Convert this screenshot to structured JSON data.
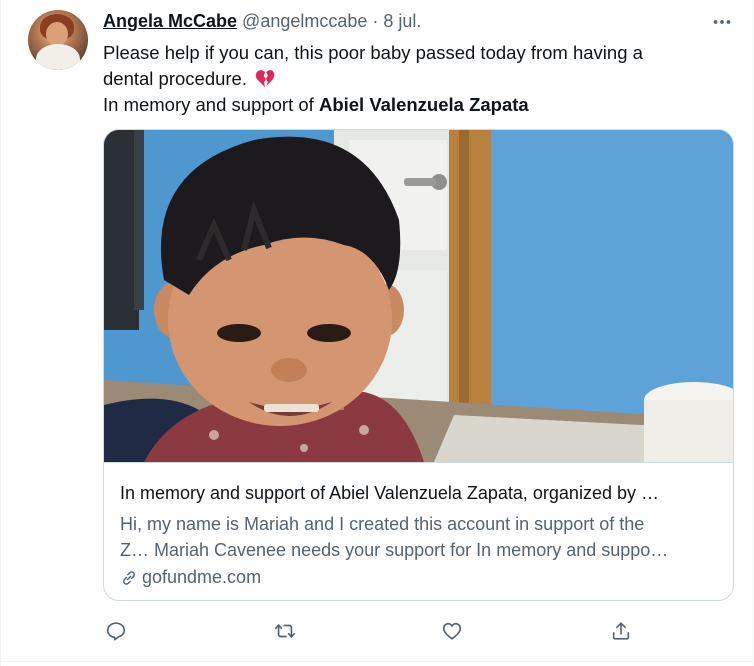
{
  "tweet": {
    "author_name": "Angela McCabe",
    "author_handle": "@angelmccabe",
    "separator": "·",
    "date": "8 jul.",
    "text_line1": "Please help if you can, this poor baby passed today from having a",
    "text_line2": "dental procedure.",
    "text_line3_prefix": "In memory and support of ",
    "text_line3_bold": "Abiel Valenzuela Zapata",
    "emoji": "broken-heart-icon"
  },
  "card": {
    "title": "In memory and support of Abiel Valenzuela Zapata, organized by …",
    "description_line1": "Hi, my name is Mariah and I created this account in support of the",
    "description_line2": "Z… Mariah Cavenee needs your support for In memory and suppo…",
    "domain": "gofundme.com",
    "image_alt": "Photo of smiling young boy with dark hair"
  },
  "actions": [
    {
      "name": "reply",
      "icon": "reply-icon"
    },
    {
      "name": "retweet",
      "icon": "retweet-icon"
    },
    {
      "name": "like",
      "icon": "heart-icon"
    },
    {
      "name": "share",
      "icon": "share-icon"
    }
  ],
  "colors": {
    "text": "#0f1419",
    "secondary": "#536471",
    "border": "#cfd9de",
    "broken_heart": "#e0245e"
  }
}
